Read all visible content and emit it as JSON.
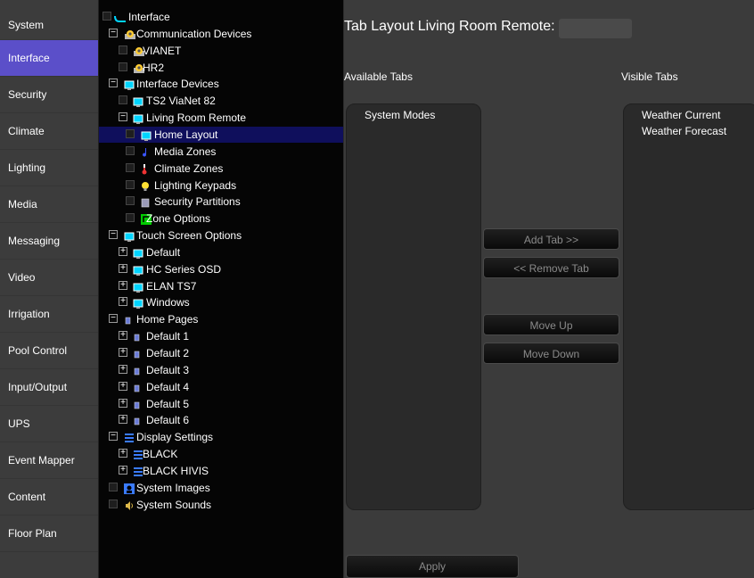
{
  "nav": [
    "System",
    "Interface",
    "Security",
    "Climate",
    "Lighting",
    "Media",
    "Messaging",
    "Video",
    "Irrigation",
    "Pool Control",
    "Input/Output",
    "UPS",
    "Event Mapper",
    "Content",
    "Floor Plan"
  ],
  "nav_active": "Interface",
  "tree": [
    {
      "label": "Interface",
      "icon": "interface-icon",
      "toggle": "box"
    },
    {
      "label": "Communication Devices",
      "icon": "gear-icon",
      "toggle": "minus"
    },
    {
      "label": "VIANET",
      "icon": "gear-icon",
      "toggle": "box"
    },
    {
      "label": "HR2",
      "icon": "gear-icon",
      "toggle": "box"
    },
    {
      "label": "Interface Devices",
      "icon": "monitor-icon",
      "toggle": "minus"
    },
    {
      "label": "TS2 ViaNet 82",
      "icon": "monitor-icon",
      "toggle": "box"
    },
    {
      "label": "Living Room Remote",
      "icon": "monitor-icon",
      "toggle": "minus"
    },
    {
      "label": "Home Layout",
      "icon": "monitor-icon",
      "toggle": "box",
      "selected": true
    },
    {
      "label": "Media Zones",
      "icon": "music-note-icon",
      "toggle": "box"
    },
    {
      "label": "Climate Zones",
      "icon": "thermometer-icon",
      "toggle": "box"
    },
    {
      "label": "Lighting Keypads",
      "icon": "bulb-icon",
      "toggle": "box"
    },
    {
      "label": "Security Partitions",
      "icon": "security-panel-icon",
      "toggle": "box"
    },
    {
      "label": "Zone Options",
      "icon": "zone-options-icon",
      "toggle": "box"
    },
    {
      "label": "Touch Screen Options",
      "icon": "monitor-icon",
      "toggle": "minus"
    },
    {
      "label": "Default",
      "icon": "monitor-icon",
      "toggle": "plus"
    },
    {
      "label": "HC Series OSD",
      "icon": "monitor-icon",
      "toggle": "plus"
    },
    {
      "label": "ELAN TS7",
      "icon": "monitor-icon",
      "toggle": "plus"
    },
    {
      "label": "Windows",
      "icon": "monitor-icon",
      "toggle": "plus"
    },
    {
      "label": "Home Pages",
      "icon": "page-icon",
      "toggle": "minus"
    },
    {
      "label": "Default 1",
      "icon": "page-icon",
      "toggle": "plus"
    },
    {
      "label": "Default 2",
      "icon": "page-icon",
      "toggle": "plus"
    },
    {
      "label": "Default 3",
      "icon": "page-icon",
      "toggle": "plus"
    },
    {
      "label": "Default 4",
      "icon": "page-icon",
      "toggle": "plus"
    },
    {
      "label": "Default 5",
      "icon": "page-icon",
      "toggle": "plus"
    },
    {
      "label": "Default 6",
      "icon": "page-icon",
      "toggle": "plus"
    },
    {
      "label": "Display Settings",
      "icon": "display-settings-icon",
      "toggle": "minus"
    },
    {
      "label": "BLACK",
      "icon": "display-settings-icon",
      "toggle": "plus"
    },
    {
      "label": "BLACK HIVIS",
      "icon": "display-settings-icon",
      "toggle": "plus"
    },
    {
      "label": "System Images",
      "icon": "image-icon",
      "toggle": "box"
    },
    {
      "label": "System Sounds",
      "icon": "speaker-icon",
      "toggle": "box"
    }
  ],
  "main": {
    "title": "Tab Layout Living Room Remote:",
    "available_header": "Available Tabs",
    "visible_header": "Visible Tabs",
    "available": [
      "System Modes"
    ],
    "visible": [
      "Weather Current",
      "Weather Forecast"
    ],
    "buttons": {
      "add": "Add Tab >>",
      "remove": "<< Remove Tab",
      "up": "Move Up",
      "down": "Move Down",
      "apply": "Apply"
    }
  },
  "colors": {
    "nav_active": "#5b4fc9",
    "selection": "#0f0f5c",
    "cyan_icon": "#00d4ff"
  }
}
